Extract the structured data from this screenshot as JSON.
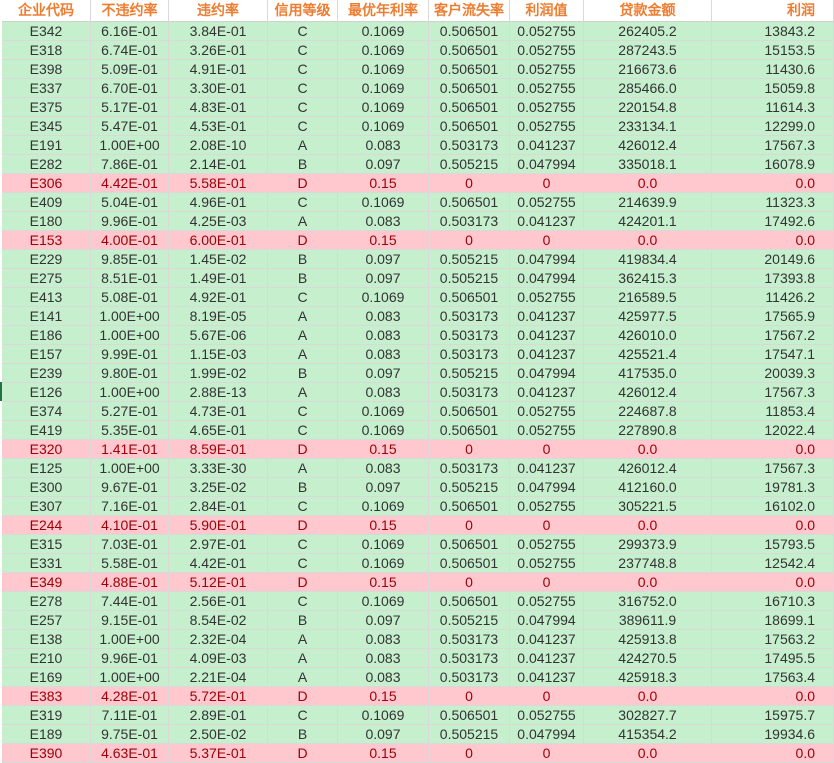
{
  "headers": [
    "企业代码",
    "不违约率",
    "违约率",
    "信用等级",
    "最优年利率",
    "客户流失率",
    "利润值",
    "贷款金额",
    "利润"
  ],
  "rows": [
    [
      "E342",
      "6.16E-01",
      "3.84E-01",
      "C",
      "0.1069",
      "0.506501",
      "0.052755",
      "262405.2",
      "13843.2"
    ],
    [
      "E318",
      "6.74E-01",
      "3.26E-01",
      "C",
      "0.1069",
      "0.506501",
      "0.052755",
      "287243.5",
      "15153.5"
    ],
    [
      "E398",
      "5.09E-01",
      "4.91E-01",
      "C",
      "0.1069",
      "0.506501",
      "0.052755",
      "216673.6",
      "11430.6"
    ],
    [
      "E337",
      "6.70E-01",
      "3.30E-01",
      "C",
      "0.1069",
      "0.506501",
      "0.052755",
      "285466.0",
      "15059.8"
    ],
    [
      "E375",
      "5.17E-01",
      "4.83E-01",
      "C",
      "0.1069",
      "0.506501",
      "0.052755",
      "220154.8",
      "11614.3"
    ],
    [
      "E345",
      "5.47E-01",
      "4.53E-01",
      "C",
      "0.1069",
      "0.506501",
      "0.052755",
      "233134.1",
      "12299.0"
    ],
    [
      "E191",
      "1.00E+00",
      "2.08E-10",
      "A",
      "0.083",
      "0.503173",
      "0.041237",
      "426012.4",
      "17567.3"
    ],
    [
      "E282",
      "7.86E-01",
      "2.14E-01",
      "B",
      "0.097",
      "0.505215",
      "0.047994",
      "335018.1",
      "16078.9"
    ],
    [
      "E306",
      "4.42E-01",
      "5.58E-01",
      "D",
      "0.15",
      "0",
      "0",
      "0.0",
      "0.0"
    ],
    [
      "E409",
      "5.04E-01",
      "4.96E-01",
      "C",
      "0.1069",
      "0.506501",
      "0.052755",
      "214639.9",
      "11323.3"
    ],
    [
      "E180",
      "9.96E-01",
      "4.25E-03",
      "A",
      "0.083",
      "0.503173",
      "0.041237",
      "424201.1",
      "17492.6"
    ],
    [
      "E153",
      "4.00E-01",
      "6.00E-01",
      "D",
      "0.15",
      "0",
      "0",
      "0.0",
      "0.0"
    ],
    [
      "E229",
      "9.85E-01",
      "1.45E-02",
      "B",
      "0.097",
      "0.505215",
      "0.047994",
      "419834.4",
      "20149.6"
    ],
    [
      "E275",
      "8.51E-01",
      "1.49E-01",
      "B",
      "0.097",
      "0.505215",
      "0.047994",
      "362415.3",
      "17393.8"
    ],
    [
      "E413",
      "5.08E-01",
      "4.92E-01",
      "C",
      "0.1069",
      "0.506501",
      "0.052755",
      "216589.5",
      "11426.2"
    ],
    [
      "E141",
      "1.00E+00",
      "8.19E-05",
      "A",
      "0.083",
      "0.503173",
      "0.041237",
      "425977.5",
      "17565.9"
    ],
    [
      "E186",
      "1.00E+00",
      "5.67E-06",
      "A",
      "0.083",
      "0.503173",
      "0.041237",
      "426010.0",
      "17567.2"
    ],
    [
      "E157",
      "9.99E-01",
      "1.15E-03",
      "A",
      "0.083",
      "0.503173",
      "0.041237",
      "425521.4",
      "17547.1"
    ],
    [
      "E239",
      "9.80E-01",
      "1.99E-02",
      "B",
      "0.097",
      "0.505215",
      "0.047994",
      "417535.0",
      "20039.3"
    ],
    [
      "E126",
      "1.00E+00",
      "2.88E-13",
      "A",
      "0.083",
      "0.503173",
      "0.041237",
      "426012.4",
      "17567.3"
    ],
    [
      "E374",
      "5.27E-01",
      "4.73E-01",
      "C",
      "0.1069",
      "0.506501",
      "0.052755",
      "224687.8",
      "11853.4"
    ],
    [
      "E419",
      "5.35E-01",
      "4.65E-01",
      "C",
      "0.1069",
      "0.506501",
      "0.052755",
      "227890.8",
      "12022.4"
    ],
    [
      "E320",
      "1.41E-01",
      "8.59E-01",
      "D",
      "0.15",
      "0",
      "0",
      "0.0",
      "0.0"
    ],
    [
      "E125",
      "1.00E+00",
      "3.33E-30",
      "A",
      "0.083",
      "0.503173",
      "0.041237",
      "426012.4",
      "17567.3"
    ],
    [
      "E300",
      "9.67E-01",
      "3.25E-02",
      "B",
      "0.097",
      "0.505215",
      "0.047994",
      "412160.0",
      "19781.3"
    ],
    [
      "E307",
      "7.16E-01",
      "2.84E-01",
      "C",
      "0.1069",
      "0.506501",
      "0.052755",
      "305221.5",
      "16102.0"
    ],
    [
      "E244",
      "4.10E-01",
      "5.90E-01",
      "D",
      "0.15",
      "0",
      "0",
      "0.0",
      "0.0"
    ],
    [
      "E315",
      "7.03E-01",
      "2.97E-01",
      "C",
      "0.1069",
      "0.506501",
      "0.052755",
      "299373.9",
      "15793.5"
    ],
    [
      "E331",
      "5.58E-01",
      "4.42E-01",
      "C",
      "0.1069",
      "0.506501",
      "0.052755",
      "237748.8",
      "12542.4"
    ],
    [
      "E349",
      "4.88E-01",
      "5.12E-01",
      "D",
      "0.15",
      "0",
      "0",
      "0.0",
      "0.0"
    ],
    [
      "E278",
      "7.44E-01",
      "2.56E-01",
      "C",
      "0.1069",
      "0.506501",
      "0.052755",
      "316752.0",
      "16710.3"
    ],
    [
      "E257",
      "9.15E-01",
      "8.54E-02",
      "B",
      "0.097",
      "0.505215",
      "0.047994",
      "389611.9",
      "18699.1"
    ],
    [
      "E138",
      "1.00E+00",
      "2.32E-04",
      "A",
      "0.083",
      "0.503173",
      "0.041237",
      "425913.8",
      "17563.2"
    ],
    [
      "E210",
      "9.96E-01",
      "4.09E-03",
      "A",
      "0.083",
      "0.503173",
      "0.041237",
      "424270.5",
      "17495.5"
    ],
    [
      "E169",
      "1.00E+00",
      "2.21E-04",
      "A",
      "0.083",
      "0.503173",
      "0.041237",
      "425918.3",
      "17563.4"
    ],
    [
      "E383",
      "4.28E-01",
      "5.72E-01",
      "D",
      "0.15",
      "0",
      "0",
      "0.0",
      "0.0"
    ],
    [
      "E319",
      "7.11E-01",
      "2.89E-01",
      "C",
      "0.1069",
      "0.506501",
      "0.052755",
      "302827.7",
      "15975.7"
    ],
    [
      "E189",
      "9.75E-01",
      "2.50E-02",
      "B",
      "0.097",
      "0.505215",
      "0.047994",
      "415354.2",
      "19934.6"
    ],
    [
      "E390",
      "4.63E-01",
      "5.37E-01",
      "D",
      "0.15",
      "0",
      "0",
      "0.0",
      "0.0"
    ]
  ],
  "colors": {
    "header_text": "#ed7d31",
    "good_fill": "#c6efce",
    "bad_fill": "#ffc7ce",
    "bad_text": "#9c0006"
  }
}
